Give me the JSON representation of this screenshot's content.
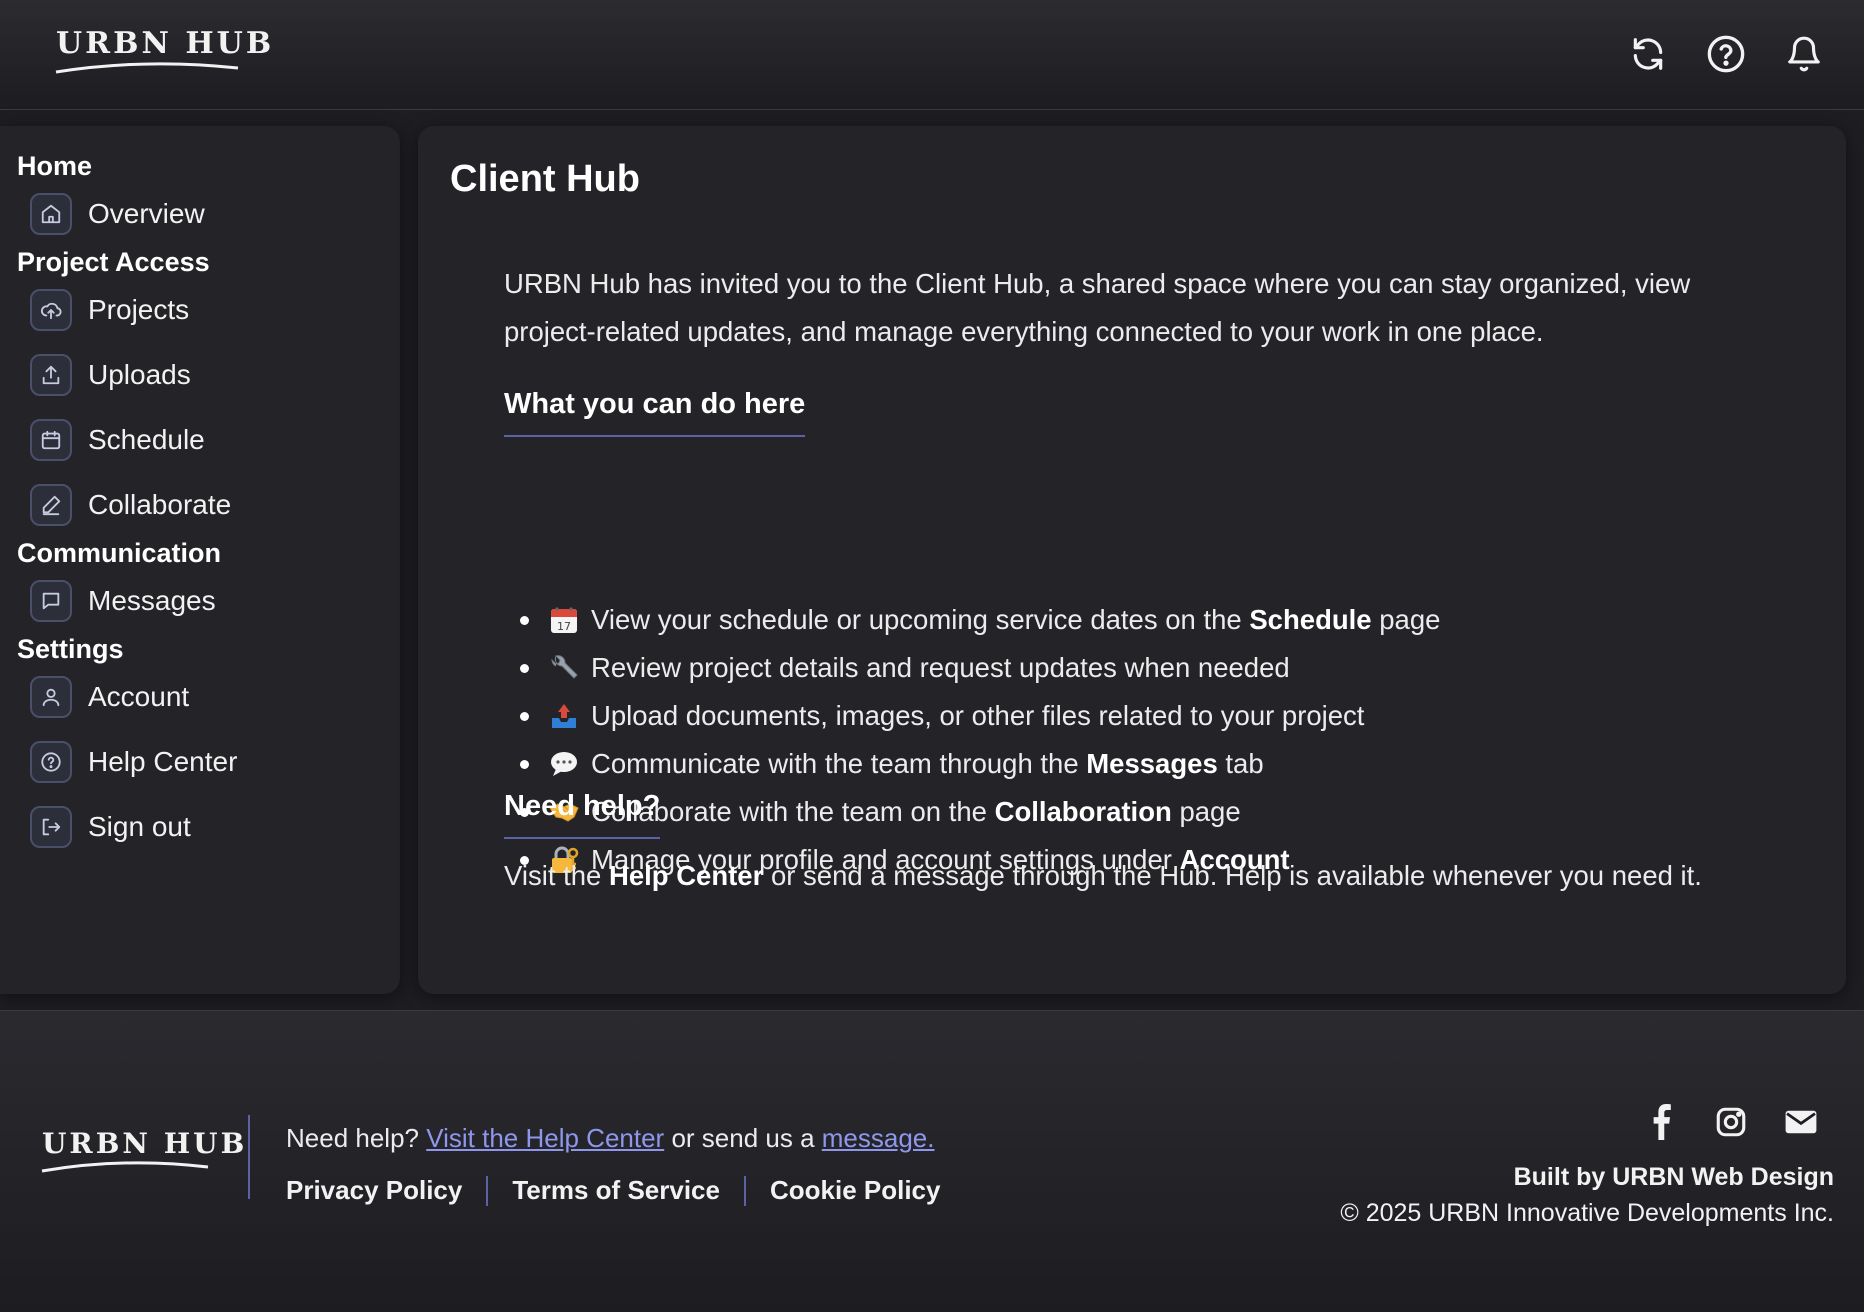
{
  "header": {
    "brand": "URBN HUB",
    "icons": [
      "refresh-icon",
      "help-circle-icon",
      "bell-icon"
    ]
  },
  "sidebar": {
    "sections": [
      {
        "title": "Home",
        "items": [
          {
            "label": "Overview",
            "icon": "home-icon"
          }
        ]
      },
      {
        "title": "Project Access",
        "items": [
          {
            "label": "Projects",
            "icon": "cloud-upload-icon"
          },
          {
            "label": "Uploads",
            "icon": "upload-icon"
          },
          {
            "label": "Schedule",
            "icon": "calendar-icon"
          },
          {
            "label": "Collaborate",
            "icon": "pencil-icon"
          }
        ]
      },
      {
        "title": "Communication",
        "items": [
          {
            "label": "Messages",
            "icon": "message-icon"
          }
        ]
      },
      {
        "title": "Settings",
        "items": [
          {
            "label": "Account",
            "icon": "user-icon"
          },
          {
            "label": "Help Center",
            "icon": "help-icon"
          },
          {
            "label": "Sign out",
            "icon": "sign-out-icon"
          }
        ]
      }
    ]
  },
  "main": {
    "title": "Client Hub",
    "intro": "URBN Hub has invited you to the Client Hub, a shared space where you can stay organized, view project-related updates, and manage everything connected to your work in one place.",
    "what_heading": "What you can do here",
    "features": [
      {
        "emoji": "calendar-emoji",
        "pre": "View your schedule or upcoming service dates on the ",
        "bold": "Schedule",
        "post": " page"
      },
      {
        "emoji": "wrench-emoji",
        "pre": "Review project details and request updates when needed",
        "bold": "",
        "post": ""
      },
      {
        "emoji": "inbox-tray-emoji",
        "pre": "Upload documents, images, or other files related to your project",
        "bold": "",
        "post": ""
      },
      {
        "emoji": "speech-bubble-emoji",
        "pre": "Communicate with the team through the ",
        "bold": "Messages",
        "post": " tab"
      },
      {
        "emoji": "handshake-emoji",
        "pre": "Collaborate with the team on the ",
        "bold": "Collaboration",
        "post": " page"
      },
      {
        "emoji": "locked-with-key-emoji",
        "pre": "Manage your profile and account settings under ",
        "bold": "Account",
        "post": ""
      }
    ],
    "help_heading": "Need help?",
    "help_pre": "Visit the ",
    "help_bold": "Help Center",
    "help_post": " or send a message through the Hub. Help is available whenever you need it."
  },
  "footer": {
    "brand": "URBN HUB",
    "help_pre": "Need help? ",
    "help_link": "Visit the Help Center",
    "help_mid": " or send us a ",
    "message_link": "message.",
    "links": [
      "Privacy Policy",
      "Terms of Service",
      "Cookie Policy"
    ],
    "social_icons": [
      "facebook-icon",
      "instagram-icon",
      "mail-icon"
    ],
    "built_by": "Built by URBN Web Design",
    "copyright": "© 2025 URBN Innovative Developments Inc."
  },
  "colors": {
    "accent": "#5b62a8",
    "link": "#8f97ec",
    "panel": "#242428",
    "background": "#1e1e22"
  }
}
